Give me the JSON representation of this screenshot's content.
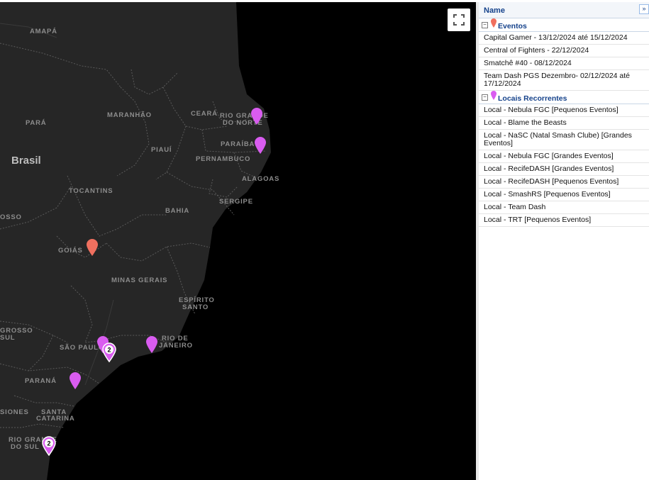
{
  "map": {
    "country_label": "Brasil",
    "state_labels": {
      "amapa": "AMAPÁ",
      "para": "PARÁ",
      "maranhao": "MARANHÃO",
      "ceara": "CEARÁ",
      "rio_grande_do_norte_1": "RIO GRANDE",
      "rio_grande_do_norte_2": "DO NORTE",
      "paraiba": "PARAÍBA",
      "piaui": "PIAUÍ",
      "pernambuco": "PERNAMBUCO",
      "alagoas": "ALAGOAS",
      "tocantins": "TOCANTINS",
      "sergipe": "SERGIPE",
      "bahia": "BAHIA",
      "mato_grosso": "OSSO",
      "goias": "GOIÁS",
      "minas_gerais": "MINAS GERAIS",
      "espirito_santo_1": "ESPÍRITO",
      "espirito_santo_2": "SANTO",
      "mato_grosso_do_sul_1": "GROSSO",
      "mato_grosso_do_sul_2": "SUL",
      "sao_paulo": "SÃO PAULO",
      "rio_de_janeiro_1": "RIO DE",
      "rio_de_janeiro_2": "JANEIRO",
      "parana": "PARANÁ",
      "missiones": "SIONES",
      "santa_catarina_1": "SANTA",
      "santa_catarina_2": "CATARINA",
      "rio_grande_do_sul_1": "RIO GRANDE",
      "rio_grande_do_sul_2": "DO SUL"
    },
    "cluster_counts": {
      "sao_paulo": "2",
      "porto_alegre": "2"
    },
    "colors": {
      "event_marker": "#f0705f",
      "recurring_marker": "#d95cf0",
      "land": "#262626",
      "water": "#000000"
    }
  },
  "panel": {
    "header": "Name",
    "collapse_symbol": "»",
    "groups": [
      {
        "title": "Eventos",
        "toggle": "−",
        "pin_color": "#f0705f",
        "items": [
          "Capital Gamer - 13/12/2024 até 15/12/2024",
          "Central of Fighters - 22/12/2024",
          "Smatchê #40 - 08/12/2024",
          "Team Dash PGS Dezembro- 02/12/2024 até 17/12/2024"
        ]
      },
      {
        "title": "Locais Recorrentes",
        "toggle": "−",
        "pin_color": "#d95cf0",
        "items": [
          "Local - Nebula FGC [Pequenos Eventos]",
          "Local - Blame the Beasts",
          "Local - NaSC (Natal Smash Clube) [Grandes Eventos]",
          "Local - Nebula FGC [Grandes Eventos]",
          "Local - RecifeDASH [Grandes Eventos]",
          "Local - RecifeDASH [Pequenos Eventos]",
          "Local - SmashRS [Pequenos Eventos]",
          "Local - Team Dash",
          "Local - TRT [Pequenos Eventos]"
        ]
      }
    ]
  }
}
